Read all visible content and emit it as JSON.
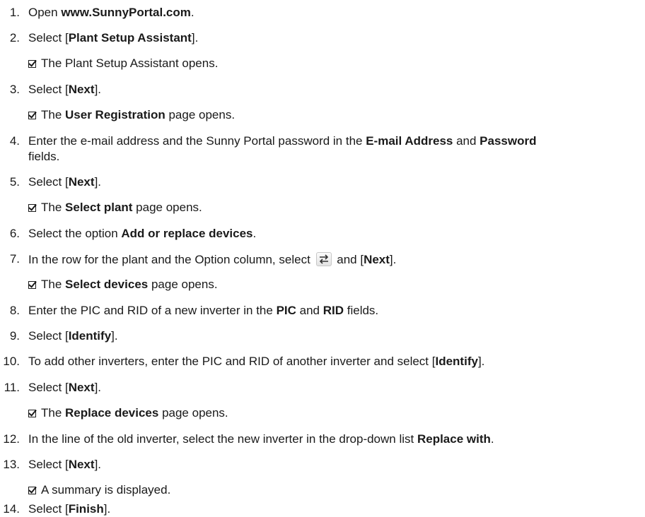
{
  "steps": [
    {
      "n": "1.",
      "pre": "Open ",
      "bold": "www.SunnyPortal.com",
      "post": "."
    },
    {
      "n": "2.",
      "pre": "Select [",
      "bold": "Plant Setup Assistant",
      "post": "]."
    },
    {
      "result_text": "The Plant Setup Assistant opens."
    },
    {
      "n": "3.",
      "pre": "Select [",
      "bold": "Next",
      "post": "]."
    },
    {
      "result_pre": "The ",
      "result_bold": "User Registration",
      "result_post": " page opens."
    },
    {
      "n": "4.",
      "pre": "Enter the e-mail address and the Sunny Portal password in the ",
      "bold": "E-mail Address",
      "mid": " and ",
      "bold2": "Password",
      "cont": "fields."
    },
    {
      "n": "5.",
      "pre": "Select [",
      "bold": "Next",
      "post": "]."
    },
    {
      "result_pre": "The ",
      "result_bold": "Select plant",
      "result_post": " page opens."
    },
    {
      "n": "6.",
      "pre": "Select the option ",
      "bold": "Add or replace devices",
      "post": "."
    },
    {
      "n": "7.",
      "pre": "In the row for the plant and the Option column, select ",
      "mid": " and [",
      "bold": "Next",
      "post": "]."
    },
    {
      "result_pre": "The ",
      "result_bold": "Select devices",
      "result_post": " page opens."
    },
    {
      "n": "8.",
      "pre": "Enter the PIC and RID of a new inverter in the ",
      "bold": "PIC",
      "mid": " and ",
      "bold2": "RID",
      "post": " fields."
    },
    {
      "n": "9.",
      "pre": "Select [",
      "bold": "Identify",
      "post": "]."
    },
    {
      "n": "10.",
      "pre": "To add other inverters, enter the PIC and RID of another inverter and select [",
      "bold": "Identify",
      "post": "]."
    },
    {
      "n": "11.",
      "pre": "Select [",
      "bold": "Next",
      "post": "]."
    },
    {
      "result_pre": "The ",
      "result_bold": "Replace devices",
      "result_post": " page opens."
    },
    {
      "n": "12.",
      "pre": "In the line of the old inverter, select the new inverter in the drop-down list ",
      "bold": "Replace with",
      "post": "."
    },
    {
      "n": "13.",
      "pre": "Select [",
      "bold": "Next",
      "post": "]."
    },
    {
      "result_text": "A summary is displayed."
    },
    {
      "n": "14.",
      "pre": "Select [",
      "bold": "Finish",
      "post": "]."
    }
  ],
  "icons": {
    "option_icon": "swap-arrows-icon",
    "result_marker": "checked-box-icon"
  }
}
